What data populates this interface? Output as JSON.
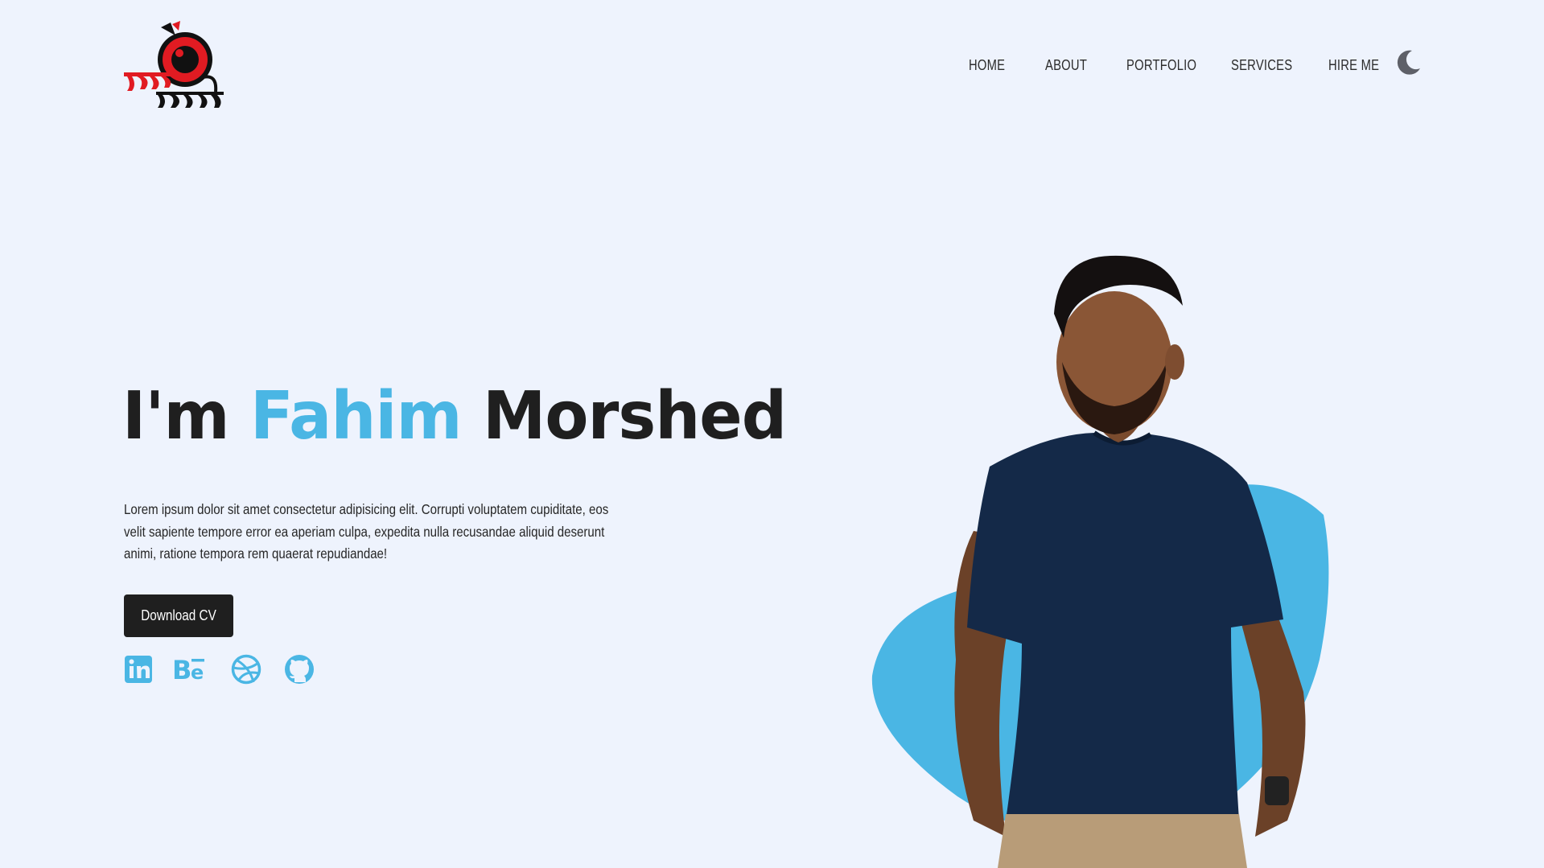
{
  "header": {
    "logo_text_top": "ফাহিম",
    "logo_text_bottom": "মোর্শেদ",
    "nav": [
      {
        "label": "HOME"
      },
      {
        "label": "ABOUT"
      },
      {
        "label": "PORTFOLIO"
      },
      {
        "label": "SERVICES"
      },
      {
        "label": "HIRE ME"
      }
    ],
    "theme_toggle_icon": "moon-icon"
  },
  "hero": {
    "title_prefix": "I'm ",
    "title_accent": "Fahim",
    "title_suffix": " Morshed",
    "description": "Lorem ipsum dolor sit amet consectetur adipisicing elit. Corrupti voluptatem cupiditate, eos velit sapiente tempore error ea aperiam culpa, expedita nulla recusandae aliquid deserunt animi, ratione tempora rem quaerat repudiandae!",
    "cta_label": "Download CV",
    "socials": [
      {
        "icon": "linkedin-icon"
      },
      {
        "icon": "behance-icon"
      },
      {
        "icon": "dribbble-icon"
      },
      {
        "icon": "github-icon"
      }
    ]
  },
  "colors": {
    "background": "#eef3fd",
    "accent": "#4ab6e4",
    "text": "#1f1f1f",
    "logo_red": "#e11b22"
  }
}
